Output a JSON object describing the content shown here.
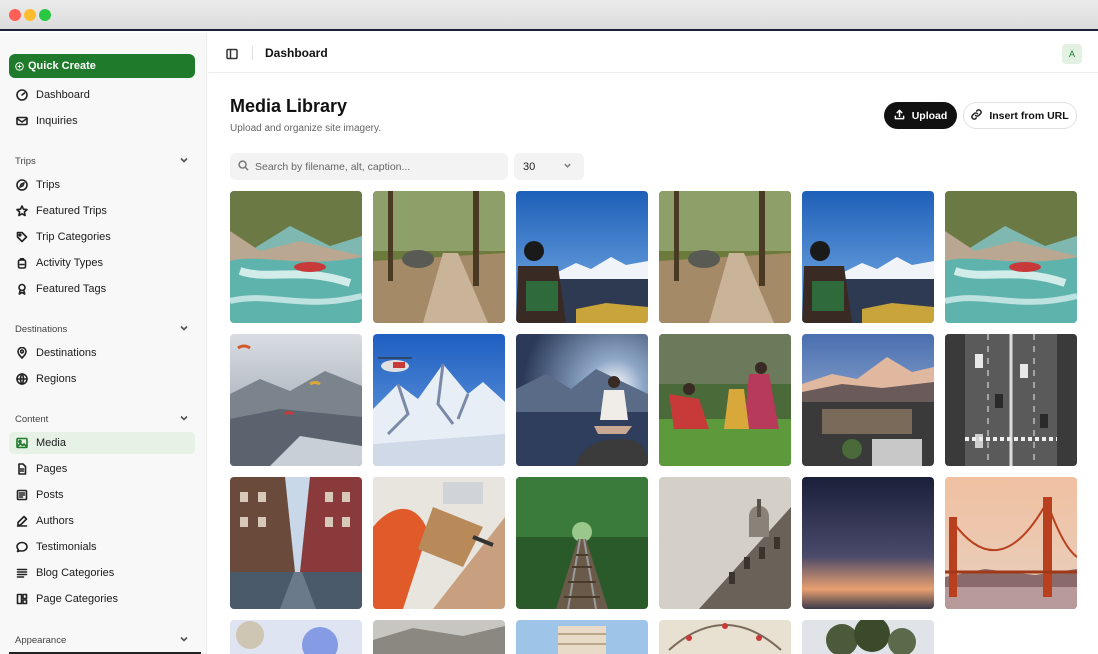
{
  "sidebar": {
    "quick_create": "Quick Create",
    "top_items": [
      {
        "label": "Dashboard",
        "icon": "dashboard-gauge-icon"
      },
      {
        "label": "Inquiries",
        "icon": "mail-icon"
      }
    ],
    "sections": [
      {
        "title": "Trips",
        "items": [
          {
            "label": "Trips",
            "icon": "compass-icon"
          },
          {
            "label": "Featured Trips",
            "icon": "star-icon"
          },
          {
            "label": "Trip Categories",
            "icon": "tag-icon"
          },
          {
            "label": "Activity Types",
            "icon": "backpack-icon"
          },
          {
            "label": "Featured Tags",
            "icon": "ribbon-icon"
          }
        ]
      },
      {
        "title": "Destinations",
        "items": [
          {
            "label": "Destinations",
            "icon": "map-pin-icon"
          },
          {
            "label": "Regions",
            "icon": "globe-icon"
          }
        ]
      },
      {
        "title": "Content",
        "items": [
          {
            "label": "Media",
            "icon": "image-icon",
            "active": true
          },
          {
            "label": "Pages",
            "icon": "file-icon"
          },
          {
            "label": "Posts",
            "icon": "newspaper-icon"
          },
          {
            "label": "Authors",
            "icon": "pen-icon"
          },
          {
            "label": "Testimonials",
            "icon": "chat-bubble-icon"
          },
          {
            "label": "Blog Categories",
            "icon": "list-icon"
          },
          {
            "label": "Page Categories",
            "icon": "layout-icon"
          }
        ]
      },
      {
        "title": "Appearance",
        "items": []
      }
    ]
  },
  "topbar": {
    "title": "Dashboard",
    "avatar_initial": "A"
  },
  "main": {
    "title": "Media Library",
    "subtitle": "Upload and organize site imagery.",
    "upload_label": "Upload",
    "insert_url_label": "Insert from URL",
    "search_placeholder": "Search by filename, alt, caption...",
    "per_page": "30"
  },
  "media_images": [
    "rafting-river",
    "elephant-forest-trail",
    "man-mountain-view",
    "elephant-forest-trail",
    "man-mountain-view",
    "rafting-river",
    "paragliders-valley",
    "helicopter-snow-peaks",
    "meditation-lake",
    "farmers-field",
    "mountain-lodge-sunset",
    "highway-traffic-bw",
    "city-street-brick",
    "desk-orange-chair",
    "railway-forest",
    "baroque-building",
    "gradient-sky-dusk",
    "golden-gate-bridge",
    "blurred-lights",
    "misty-landscape",
    "leaning-tower",
    "ferris-wheel",
    "tree-silhouette"
  ],
  "colors": {
    "brand": "#1f7a2c",
    "active_bg": "#e6f2e6"
  }
}
